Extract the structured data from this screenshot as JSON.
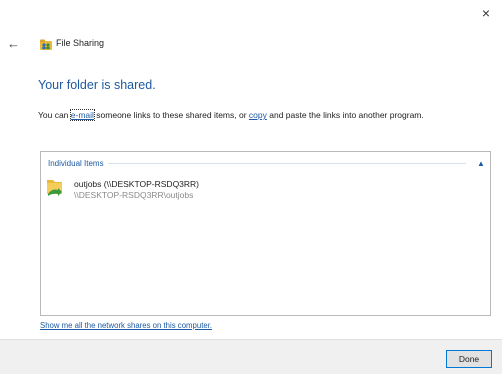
{
  "window": {
    "title": "File Sharing",
    "close_glyph": "×",
    "back_glyph": "←",
    "title_icon": "file-sharing-icon"
  },
  "main": {
    "heading": "Your folder is shared.",
    "description": {
      "part1": "You can ",
      "email_link": "e-mail",
      "part2": " someone links to these shared items, or ",
      "copy_link": "copy",
      "part3": " and paste the links into another program."
    }
  },
  "items": {
    "group_label": "Individual Items",
    "chevron": "▲",
    "list": [
      {
        "name": "outjobs (\\\\DESKTOP-RSDQ3RR)",
        "path": "\\\\DESKTOP-RSDQ3RR\\outjobs",
        "icon": "shared-folder-icon"
      }
    ]
  },
  "network_link": "Show me all the network shares on this computer.",
  "footer": {
    "done_label": "Done"
  },
  "colors": {
    "accent": "#1d5aa3",
    "focus_border": "#0078d7",
    "footer_bg": "#f0f0f0"
  }
}
